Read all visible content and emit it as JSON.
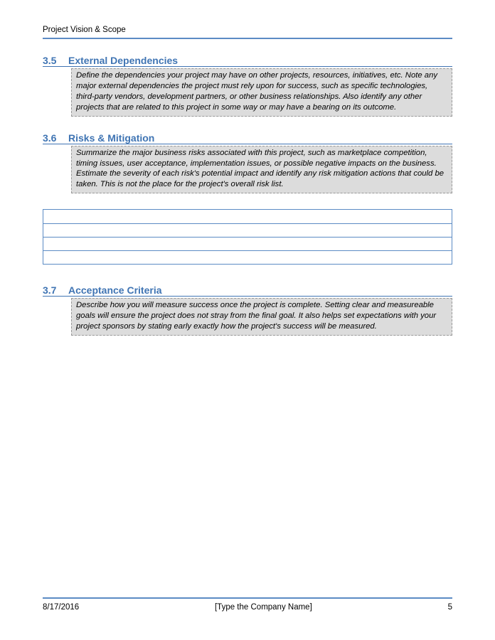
{
  "header": {
    "title": "Project Vision & Scope"
  },
  "sections": [
    {
      "number": "3.5",
      "title": "External Dependencies",
      "body": "Define the dependencies your project may have on other projects, resources, initiatives, etc.  Note any major external dependencies the project must rely upon for success, such as specific technologies, third-party vendors, development partners, or other business relationships. Also identify any other projects that are related to this project in some way or may have a bearing on its outcome."
    },
    {
      "number": "3.6",
      "title": "Risks & Mitigation",
      "body": "Summarize the major business risks associated with this project, such as marketplace competition, timing issues, user acceptance, implementation issues, or possible negative impacts on the business. Estimate the severity of each risk's potential impact and identify any risk mitigation actions that could be taken. This is not the place for the project's overall risk list."
    },
    {
      "number": "3.7",
      "title": "Acceptance Criteria",
      "body": "Describe how you will measure success once the project is complete. Setting clear and measureable goals will ensure the project does not stray from the final goal. It also helps set expectations with your project sponsors by stating early exactly how the project's success will be measured."
    }
  ],
  "table": {
    "rows": 4
  },
  "footer": {
    "date": "8/17/2016",
    "center": "[Type the Company Name]",
    "page": "5"
  }
}
